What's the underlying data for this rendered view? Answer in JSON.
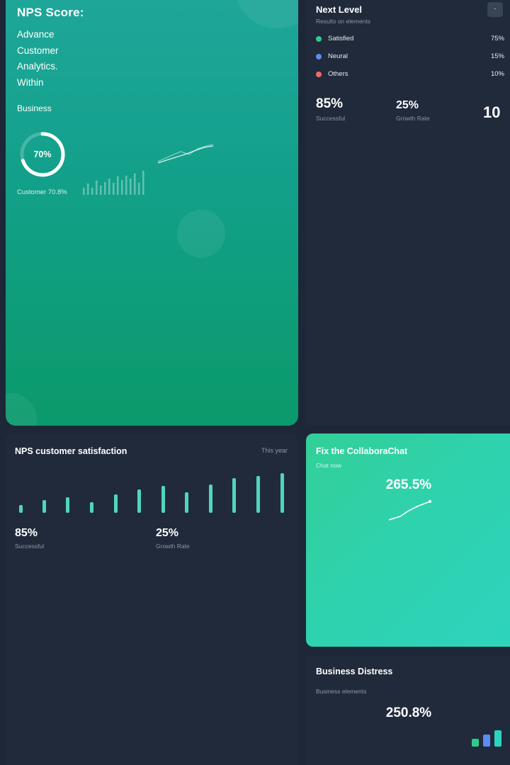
{
  "hero": {
    "title": "NPS Score:",
    "lines": [
      "Advance",
      "Customer",
      "Analytics.",
      "Within"
    ],
    "business_label": "Business",
    "ring_value": "70%",
    "ring_percent": 70,
    "ring_caption": "Customer 70.8%",
    "color_bg_top": "#1fa79a",
    "color_bg_bottom": "#0b9a6a"
  },
  "next_level": {
    "title": "Next Level",
    "subtitle": "Results on elements",
    "button_icon": "minus-icon",
    "button_label": "-",
    "legend": [
      {
        "label": "Satisfied",
        "value": "75%",
        "color": "#2ecc8a"
      },
      {
        "label": "Neural",
        "value": "15%",
        "color": "#5b8def"
      },
      {
        "label": "Others",
        "value": "10%",
        "color": "#ef6b6b"
      }
    ],
    "stat1_value": "85%",
    "stat1_label": "Successful",
    "stat2_value": "25%",
    "stat2_label": "Growth Rate",
    "stat3_value": "10"
  },
  "satisfaction": {
    "title": "NPS customer satisfaction",
    "period": "This year",
    "stat1_value": "85%",
    "stat1_label": "Successful",
    "stat2_value": "25%",
    "stat2_label": "Growth Rate",
    "bar_color": "#4fd6bd"
  },
  "collabora": {
    "title": "Fix the CollaboraChat",
    "subtitle": "Chat now",
    "value": "265.5%"
  },
  "distress": {
    "title": "Business Distress",
    "subtitle": "Business elements",
    "value": "250.8%",
    "bar_colors": [
      "#2ecc8a",
      "#5b8def",
      "#2ed3bd"
    ]
  }
}
